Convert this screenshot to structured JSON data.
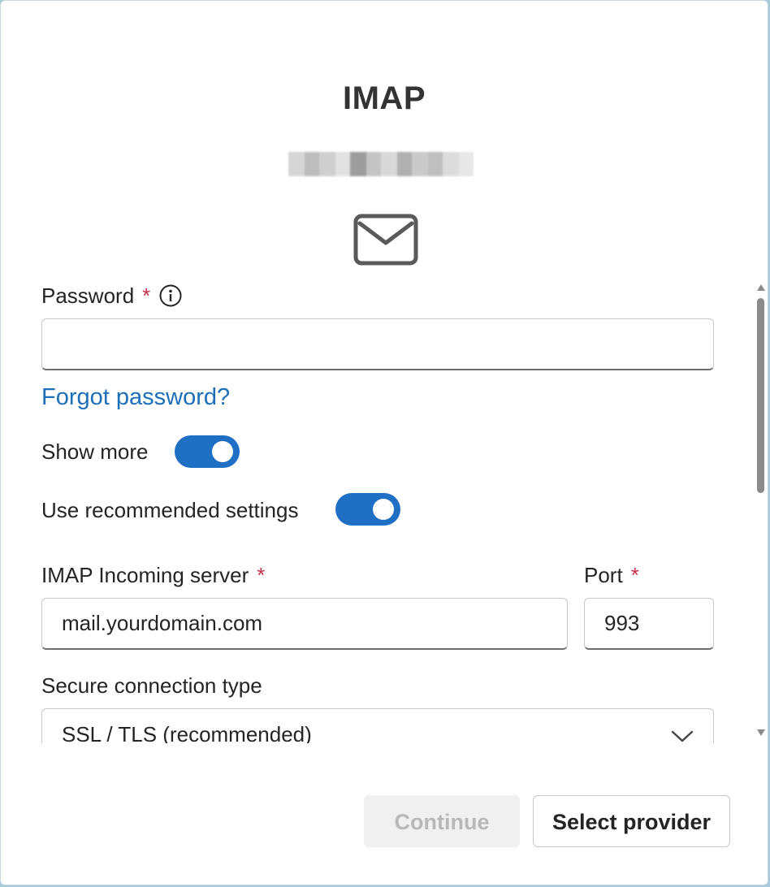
{
  "header": {
    "title": "IMAP",
    "account_email_obscured": ""
  },
  "form": {
    "password": {
      "label": "Password",
      "required_marker": "*",
      "value": "",
      "placeholder": ""
    },
    "forgot_password_link": "Forgot password?",
    "show_more": {
      "label": "Show more",
      "on": true
    },
    "use_recommended": {
      "label": "Use recommended settings",
      "on": true
    },
    "incoming_server": {
      "label": "IMAP Incoming server",
      "required_marker": "*",
      "value": "mail.yourdomain.com"
    },
    "port": {
      "label": "Port",
      "required_marker": "*",
      "value": "993"
    },
    "connection_type": {
      "label": "Secure connection type",
      "selected": "SSL / TLS (recommended)"
    }
  },
  "buttons": {
    "continue": "Continue",
    "continue_disabled": true,
    "select_provider": "Select provider"
  },
  "colors": {
    "accent": "#1f6fc4",
    "link": "#1d6fb8",
    "required": "#c4314b",
    "disabled_bg": "#f0f0f0",
    "disabled_text": "#b8b8b8"
  },
  "icons": {
    "mail": "mail-envelope-icon",
    "info": "info-icon",
    "chevron": "chevron-down-icon"
  }
}
